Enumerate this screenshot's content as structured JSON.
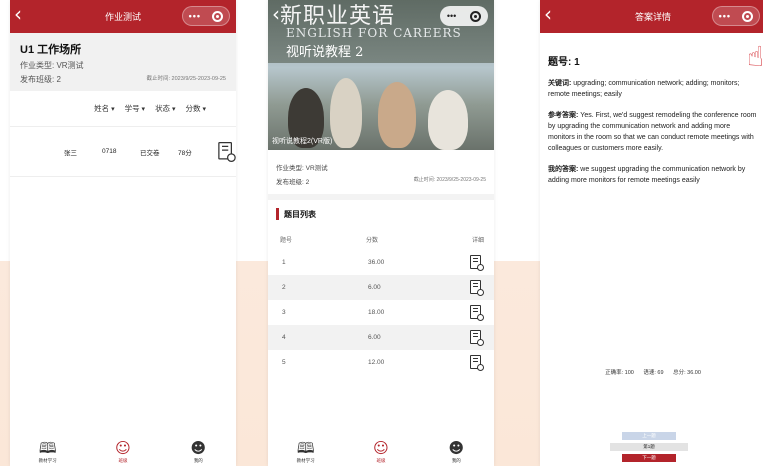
{
  "screen1": {
    "title": "作业测试",
    "homework_title": "U1 工作场所",
    "homework_type": "作业类型: VR测试",
    "class": "发布班级: 2",
    "deadline": "截止时间: 2023/9/25-2023-09-25",
    "sort_labels": [
      "姓名",
      "学号",
      "状态",
      "分数"
    ],
    "student": {
      "name": "张三",
      "id": "0718",
      "status": "已交卷",
      "score": "78分"
    },
    "tabs": [
      {
        "label": "教材学习",
        "icon": "book-icon"
      },
      {
        "label": "班级",
        "icon": "class-icon"
      },
      {
        "label": "我的",
        "icon": "user-icon"
      }
    ]
  },
  "screen2": {
    "cover_cn": "新职业英语",
    "cover_en": "ENGLISH FOR CAREERS",
    "cover_sub": "视听说教程 2",
    "course_label": "视听说教程2(VR版)",
    "homework_type": "作业类型: VR测试",
    "class": "发布班级: 2",
    "deadline": "截止时间: 2023/9/25-2023-09-25",
    "section_title": "题目列表",
    "columns": [
      "题号",
      "分数",
      "详细"
    ],
    "rows": [
      {
        "no": "1",
        "score": "36.00"
      },
      {
        "no": "2",
        "score": "6.00"
      },
      {
        "no": "3",
        "score": "18.00"
      },
      {
        "no": "4",
        "score": "6.00"
      },
      {
        "no": "5",
        "score": "12.00"
      }
    ],
    "tabs": [
      {
        "label": "教材学习",
        "icon": "book-icon"
      },
      {
        "label": "班级",
        "icon": "class-icon"
      },
      {
        "label": "我的",
        "icon": "user-icon"
      }
    ]
  },
  "screen3": {
    "title": "答案详情",
    "question_no": "题号: 1",
    "keywords_label": "关键词:",
    "keywords": " upgrading; communication network; adding; monitors; remote meetings; easily",
    "reference_label": "参考答案:",
    "reference": " Yes. First, we'd suggest remodeling the conference room by upgrading the communication network and adding more monitors in the room so that we can conduct remote meetings with colleagues or customers more easily.",
    "my_label": "我的答案:",
    "my_answer": " we suggest upgrading the communication network by adding more monitors for remote meetings easily",
    "accuracy": "正确率: 100",
    "fluency": "语速: 69",
    "total": "总分: 36.00",
    "prev": "上一题",
    "page": "第1题",
    "next": "下一题"
  }
}
